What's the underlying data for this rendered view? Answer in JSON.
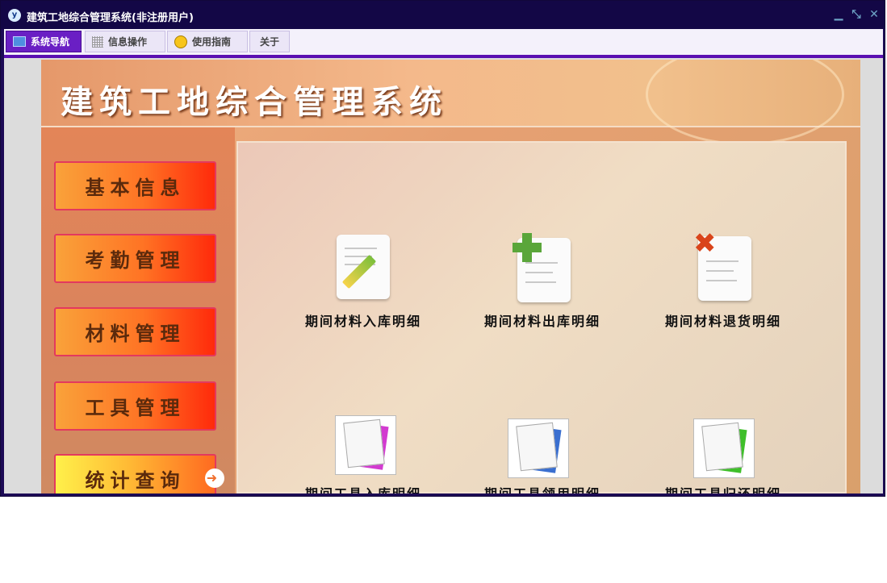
{
  "window": {
    "title": "建筑工地综合管理系统(非注册用户)",
    "controls": [
      "minimize-icon",
      "restore-icon",
      "close-icon"
    ]
  },
  "menubar": {
    "tabs": [
      {
        "label": "系统导航",
        "icon": "monitor-icon",
        "active": true
      },
      {
        "label": "信息操作",
        "icon": "grid-icon",
        "active": false
      },
      {
        "label": "使用指南",
        "icon": "compass-icon",
        "active": false
      },
      {
        "label": "关于",
        "icon": "",
        "active": false
      }
    ]
  },
  "banner": {
    "title": "建筑工地综合管理系统"
  },
  "sidebar": {
    "items": [
      {
        "label": "基本信息"
      },
      {
        "label": "考勤管理"
      },
      {
        "label": "材料管理"
      },
      {
        "label": "工具管理"
      },
      {
        "label": "统计查询",
        "selected": true
      }
    ]
  },
  "panel": {
    "items": [
      {
        "label": "期间材料入库明细",
        "icon": "pencil-document-icon"
      },
      {
        "label": "期间材料出库明细",
        "icon": "add-document-icon"
      },
      {
        "label": "期间材料退货明细",
        "icon": "delete-document-icon"
      },
      {
        "label": "期间工具入库明细",
        "icon": "magenta-papers-icon"
      },
      {
        "label": "期间工具领用明细",
        "icon": "blue-papers-icon"
      },
      {
        "label": "期间工具归还明细",
        "icon": "green-papers-icon"
      }
    ]
  },
  "colors": {
    "titlebar": "#130746",
    "accent": "#5a0fb1",
    "nav_button_red": "#ff2a0b",
    "nav_button_orange": "#f9a23a"
  }
}
